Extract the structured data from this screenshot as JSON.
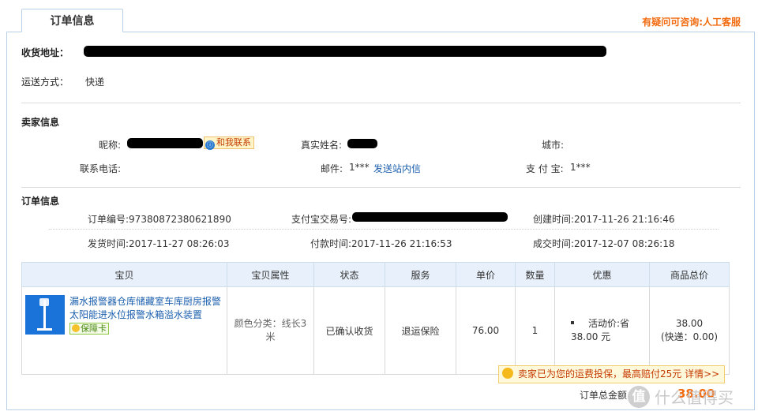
{
  "tab": {
    "title": "订单信息"
  },
  "help_link": "有疑问可咨询:人工客服",
  "shipping": {
    "address_label": "收货地址：",
    "method_label": "运送方式：",
    "method_value": "快递"
  },
  "seller": {
    "section_title": "卖家信息",
    "nickname_label": "昵称:",
    "contact_button": "和我联系",
    "realname_label": "真实姓名:",
    "city_label": "城市:",
    "phone_label": "联系电话:",
    "email_label": "邮件:",
    "email_value": "1***",
    "message_link": "发送站内信",
    "alipay_label": "支 付 宝:",
    "alipay_value": "1***"
  },
  "order": {
    "section_title": "订单信息",
    "order_no": "订单编号:97380872380621890",
    "alipay_trade_label": "支付宝交易号:",
    "created": "创建时间:2017-11-26 21:16:46",
    "shipped": "发货时间:2017-11-27 08:26:03",
    "paid": "付款时间:2017-11-26 21:16:53",
    "completed": "成交时间:2017-12-07 08:26:18"
  },
  "table": {
    "headers": [
      "宝贝",
      "宝贝属性",
      "状态",
      "服务",
      "单价",
      "数量",
      "优惠",
      "商品总价"
    ],
    "row": {
      "title": "漏水报警器仓库储藏室车库厨房报警太阳能进水位报警水箱溢水装置",
      "guarantee": "保障卡",
      "attr": "颜色分类：线长3米",
      "status": "已确认收货",
      "service": "退运保险",
      "unit_price": "76.00",
      "quantity": "1",
      "promo_line1": "活动价:省",
      "promo_line2": "38.00 元",
      "total": "38.00",
      "shipping_fee": "(快递：0.00)"
    }
  },
  "notice": "卖家已为您的运费投保，最高赔付25元 详情>>",
  "total": {
    "label": "订单总金额",
    "value": "38.00"
  },
  "watermark": {
    "symbol": "值",
    "text": "什么值得买"
  },
  "colors": {
    "link": "#1b5fae",
    "accent": "#f26b0f",
    "header_bg": "#e8f1fb",
    "border": "#b9d0e6"
  }
}
